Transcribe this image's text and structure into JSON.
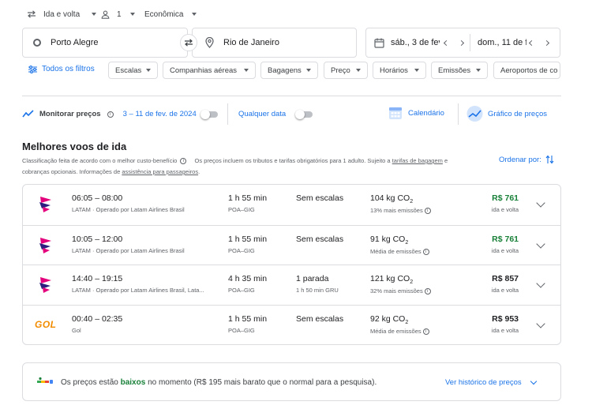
{
  "trip": {
    "type": "Ida e volta",
    "passengers": "1",
    "cabin": "Econômica",
    "origin": "Porto Alegre",
    "destination": "Rio de Janeiro",
    "depart_date": "sáb., 3 de fev",
    "return_date": "dom., 11 de f"
  },
  "filters": {
    "all": "Todos os filtros",
    "chips": [
      "Escalas",
      "Companhias aéreas",
      "Bagagens",
      "Preço",
      "Horários",
      "Emissões",
      "Aeroportos de co"
    ]
  },
  "monitor": {
    "label": "Monitorar preços",
    "dates": "3 – 11 de fev. de 2024",
    "any_date": "Qualquer data",
    "calendar": "Calendário",
    "graph": "Gráfico de preços"
  },
  "section": {
    "title": "Melhores voos de ida",
    "note1": "Classificação feita de acordo com o melhor custo-benefício",
    "note2": "Os preços incluem os tributos e tarifas obrigatórios para 1 adulto. Sujeito a",
    "note_link1": "tarifas de bagagem",
    "note3": "e cobranças opcionais. Informações de",
    "note_link2": "assistência para passageiros",
    "note_end": ".",
    "sort": "Ordenar por:"
  },
  "flights": [
    {
      "airline_logo": "latam",
      "times": "06:05 – 08:00",
      "carrier": "LATAM · Operado por Latam Airlines Brasil",
      "duration": "1 h 55 min",
      "route": "POA–GIG",
      "stops": "Sem escalas",
      "stops_detail": "",
      "co2": "104 kg CO",
      "co2_sub": "2",
      "emission_note": "13% mais emissões",
      "price": "R$ 761",
      "price_color": "#188038",
      "price_note": "ida e volta"
    },
    {
      "airline_logo": "latam",
      "times": "10:05 – 12:00",
      "carrier": "LATAM · Operado por Latam Airlines Brasil",
      "duration": "1 h 55 min",
      "route": "POA–GIG",
      "stops": "Sem escalas",
      "stops_detail": "",
      "co2": "91 kg CO",
      "co2_sub": "2",
      "emission_note": "Média de emissões",
      "price": "R$ 761",
      "price_color": "#188038",
      "price_note": "ida e volta"
    },
    {
      "airline_logo": "latam",
      "times": "14:40 – 19:15",
      "carrier": "LATAM · Operado por Latam Airlines Brasil, Lata...",
      "duration": "4 h 35 min",
      "route": "POA–GIG",
      "stops": "1 parada",
      "stops_detail": "1 h 50 min GRU",
      "co2": "121 kg CO",
      "co2_sub": "2",
      "emission_note": "32% mais emissões",
      "price": "R$ 857",
      "price_color": "#202124",
      "price_note": "ida e volta"
    },
    {
      "airline_logo": "gol",
      "airline_logo_text": "GOL",
      "times": "00:40 – 02:35",
      "carrier": "Gol",
      "duration": "1 h 55 min",
      "route": "POA–GIG",
      "stops": "Sem escalas",
      "stops_detail": "",
      "co2": "92 kg CO",
      "co2_sub": "2",
      "emission_note": "Média de emissões",
      "price": "R$ 953",
      "price_color": "#202124",
      "price_note": "ida e volta"
    }
  ],
  "banner": {
    "pre": "Os preços estão",
    "highlight": "baixos",
    "post": "no momento (R$ 195 mais barato que o normal para a pesquisa).",
    "link": "Ver histórico de preços"
  },
  "colors": {
    "accent": "#1a73e8",
    "low_price": "#188038",
    "gol_orange": "#f28c00",
    "latam_magenta": "#e4007c",
    "latam_indigo": "#2b1e7e"
  }
}
